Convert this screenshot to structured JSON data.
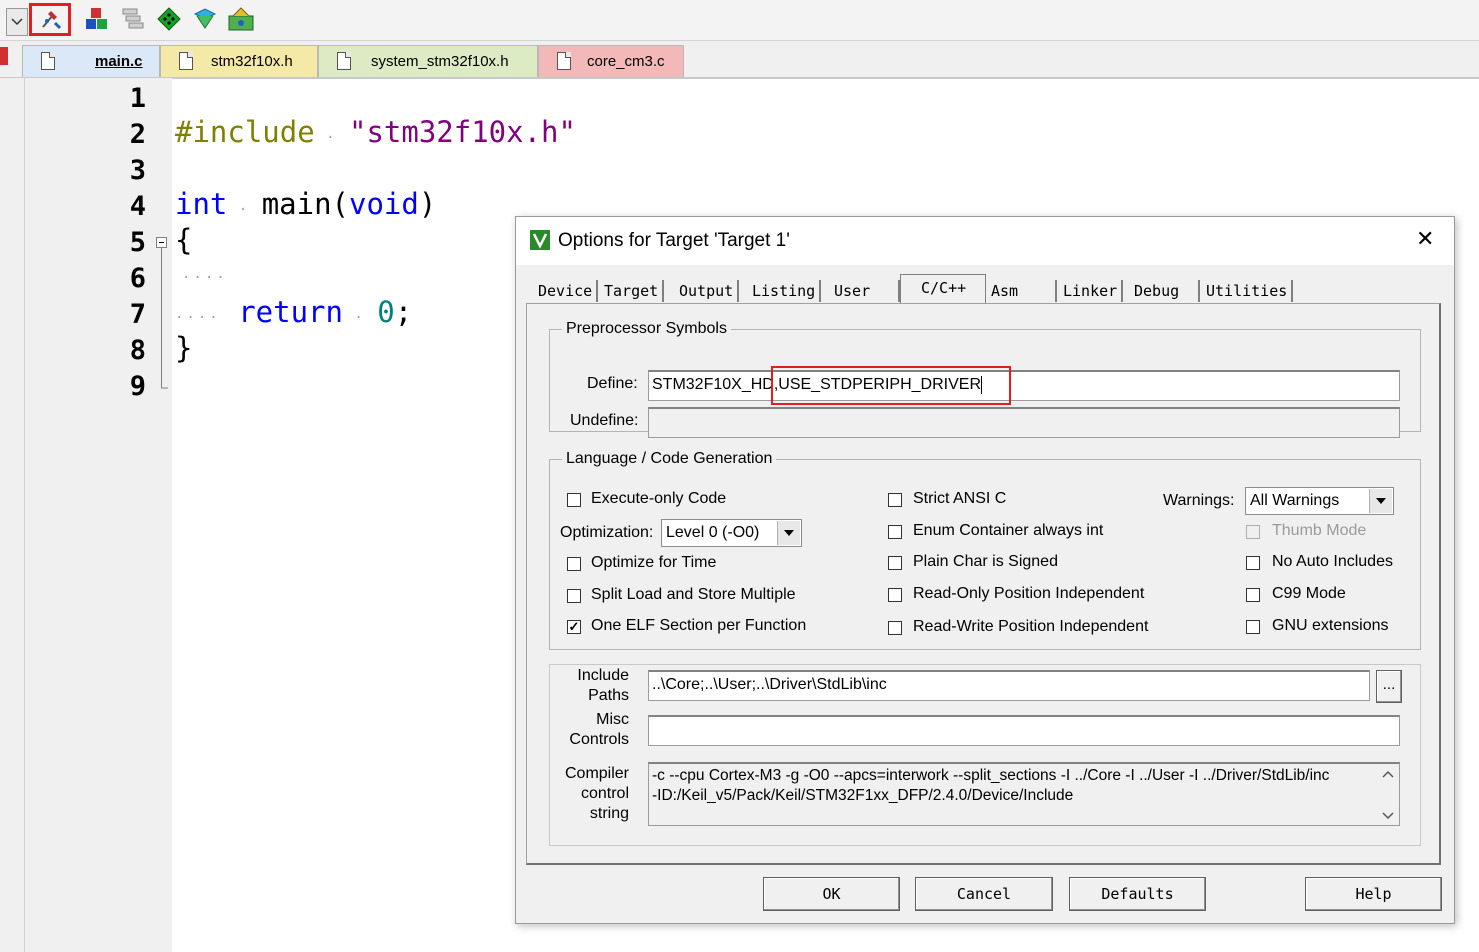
{
  "toolbar": {
    "buttons": [
      {
        "icon": "options-for-target-icon",
        "highlighted": true
      },
      {
        "icon": "manage-components-icon"
      },
      {
        "icon": "select-software-packs-icon"
      },
      {
        "icon": "pack-installer-icon"
      },
      {
        "icon": "manage-run-time-environment-icon"
      },
      {
        "icon": "project-items-icon"
      }
    ]
  },
  "tabs": [
    {
      "label": "main.c",
      "active": true,
      "color": "#dbe8f7"
    },
    {
      "label": "stm32f10x.h",
      "color": "#f5e9a8"
    },
    {
      "label": "system_stm32f10x.h",
      "color": "#dcebc4"
    },
    {
      "label": "core_cm3.c",
      "color": "#f3b9b9"
    }
  ],
  "editor": {
    "line_numbers": [
      "1",
      "2",
      "3",
      "4",
      "5",
      "6",
      "7",
      "8",
      "9"
    ],
    "lines": {
      "l2_pp": "#include",
      "l2_str": "\"stm32f10x.h\"",
      "l4_kw1": "int",
      "l4_fn": "main(",
      "l4_kw2": "void",
      "l4_close": ")",
      "l5": "{",
      "l7_kw": "return",
      "l7_num": "0",
      "l7_semi": ";",
      "l8": "}"
    }
  },
  "dialog": {
    "title": "Options for Target 'Target 1'",
    "close_glyph": "✕",
    "tabs": [
      "Device",
      "Target",
      "Output",
      "Listing",
      "User",
      "C/C++",
      "Asm",
      "Linker",
      "Debug",
      "Utilities"
    ],
    "active_tab": "C/C++",
    "preprocessor": {
      "legend": "Preprocessor Symbols",
      "define_label": "Define:",
      "define_value_part1": "STM32F10X_HD",
      "define_value_part2": ",USE_STDPERIPH_DRIVER",
      "undefine_label": "Undefine:",
      "undefine_value": ""
    },
    "language": {
      "legend": "Language / Code Generation",
      "execute_only": {
        "label": "Execute-only Code",
        "checked": false
      },
      "optimization_label": "Optimization:",
      "optimization_value": "Level 0 (-O0)",
      "optimize_time": {
        "label": "Optimize for Time",
        "checked": false
      },
      "split_load": {
        "label": "Split Load and Store Multiple",
        "checked": false
      },
      "one_elf": {
        "label": "One ELF Section per Function",
        "checked": true
      },
      "strict_ansi": {
        "label": "Strict ANSI C",
        "checked": false
      },
      "enum_container": {
        "label": "Enum Container always int",
        "checked": false
      },
      "plain_char": {
        "label": "Plain Char is Signed",
        "checked": false
      },
      "ro_pos": {
        "label": "Read-Only Position Independent",
        "checked": false
      },
      "rw_pos": {
        "label": "Read-Write Position Independent",
        "checked": false
      },
      "warnings_label": "Warnings:",
      "warnings_value": "All Warnings",
      "thumb_mode": {
        "label": "Thumb Mode",
        "checked": false,
        "disabled": true
      },
      "no_auto_includes": {
        "label": "No Auto Includes",
        "checked": false
      },
      "c99_mode": {
        "label": "C99 Mode",
        "checked": false
      },
      "gnu_ext": {
        "label": "GNU extensions",
        "checked": false
      }
    },
    "include_paths_label_1": "Include",
    "include_paths_label_2": "Paths",
    "include_paths_value": "..\\Core;..\\User;..\\Driver\\StdLib\\inc",
    "browse_label": "...",
    "misc_label_1": "Misc",
    "misc_label_2": "Controls",
    "misc_value": "",
    "compiler_label_1": "Compiler",
    "compiler_label_2": "control",
    "compiler_label_3": "string",
    "compiler_line1": "-c --cpu Cortex-M3 -g -O0 --apcs=interwork --split_sections -I ../Core -I ../User -I ../Driver/StdLib/inc",
    "compiler_line2": "-ID:/Keil_v5/Pack/Keil/STM32F1xx_DFP/2.4.0/Device/Include",
    "buttons": {
      "ok": "OK",
      "cancel": "Cancel",
      "defaults": "Defaults",
      "help": "Help"
    }
  }
}
